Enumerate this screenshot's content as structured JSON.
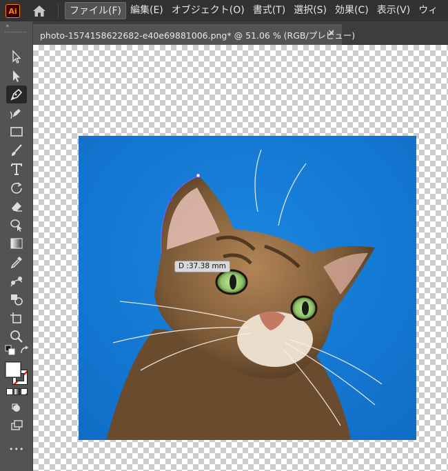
{
  "app": {
    "logo_text": "Ai",
    "brand_color": "#ff7f18"
  },
  "menu": {
    "items": [
      {
        "label": "ファイル(F)"
      },
      {
        "label": "編集(E)"
      },
      {
        "label": "オブジェクト(O)"
      },
      {
        "label": "書式(T)"
      },
      {
        "label": "選択(S)"
      },
      {
        "label": "効果(C)"
      },
      {
        "label": "表示(V)"
      },
      {
        "label": "ウィ"
      }
    ]
  },
  "document": {
    "tab_title": "photo-1574158622682-e40e69881006.png* @ 51.06 % (RGB/プレビュー)",
    "close_glyph": "✕"
  },
  "toolbar": {
    "collapse_glyph": "»",
    "tools": [
      {
        "icon": "selection-arrow-icon"
      },
      {
        "icon": "direct-selection-icon"
      },
      {
        "icon": "pen-icon"
      },
      {
        "icon": "curvature-icon"
      },
      {
        "icon": "rectangle-icon"
      },
      {
        "icon": "paintbrush-icon"
      },
      {
        "icon": "type-icon"
      },
      {
        "icon": "rotate-icon"
      },
      {
        "icon": "eraser-icon"
      },
      {
        "icon": "free-transform-icon"
      },
      {
        "icon": "gradient-icon"
      },
      {
        "icon": "eyedropper-icon"
      },
      {
        "icon": "blend-icon"
      },
      {
        "icon": "shape-builder-icon"
      },
      {
        "icon": "artboard-icon"
      },
      {
        "icon": "zoom-icon"
      }
    ],
    "more_glyph": "•••"
  },
  "canvas": {
    "measure_label": "D :37.38 mm",
    "photo_background": "#1478d4"
  }
}
